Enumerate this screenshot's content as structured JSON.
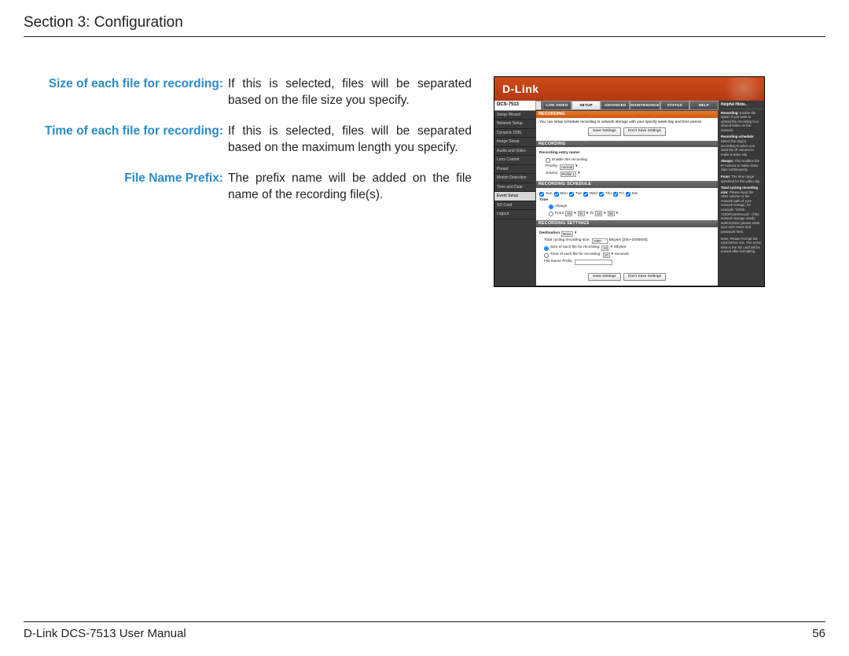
{
  "header": {
    "section_title": "Section 3: Configuration"
  },
  "defs": [
    {
      "label": "Size of each file for recording:",
      "desc": "If this is selected, files will be separated based on the file size you specify."
    },
    {
      "label": "Time of each file for recording:",
      "desc": "If this is selected, files will be separated based on the maximum length you specify."
    },
    {
      "label": "File Name Prefix:",
      "desc": "The prefix name will be added on the file name of the recording file(s)."
    }
  ],
  "shot": {
    "brand": "D-Link",
    "model": "DCS-7513",
    "side_items": [
      "Setup Wizard",
      "Network Setup",
      "Dynamic DNS",
      "Image Setup",
      "Audio and Video",
      "Lens Control",
      "Preset",
      "Motion Detection",
      "Time and Date",
      "Event Setup",
      "SD Card",
      "Logout"
    ],
    "side_current_index": 9,
    "tabs": [
      "LIVE VIDEO",
      "SETUP",
      "ADVANCED",
      "MAINTENANCE",
      "STATUS",
      "HELP"
    ],
    "tab_active_index": 1,
    "orange_title": "RECORDING",
    "intro": "You can setup schedule recording to network storage with your specify week day and time period.",
    "btn_save": "Save Settings",
    "btn_dont": "Don't Save Settings",
    "panel_recording": {
      "title": "RECORDING",
      "entry_label": "Recording entry name:",
      "enable_label": "Enable this recording",
      "priority_label": "Priority:",
      "priority_value": "normal",
      "source_label": "Source:",
      "source_value": "Profile 1"
    },
    "panel_schedule": {
      "title": "RECORDING SCHEDULE",
      "days": [
        "Sun",
        "Mon",
        "Tue",
        "Wed",
        "Thu",
        "Fri",
        "Sat"
      ],
      "time_label": "Time",
      "always_label": "Always",
      "from_label": "From",
      "from_h": "00",
      "from_m": "00",
      "to_label": "To",
      "to_h": "23",
      "to_m": "59"
    },
    "panel_settings": {
      "title": "RECORDING SETTINGS",
      "dest_label": "Destination",
      "dest_value": "None",
      "cycle_label": "Total cycling recording size:",
      "cycle_value": "1000",
      "cycle_units": "Mbytes [200~2000000]",
      "size_label": "Size of each file for recording:",
      "size_value": "10",
      "size_units": "Mbytes",
      "time_label": "Time of each file for recording:",
      "time_value": "10",
      "time_units": "seconds",
      "prefix_label": "File Name Prefix:"
    },
    "help": {
      "title": "Helpful Hints..",
      "p1b": "Recording:",
      "p1": " Enable the option if you want to upload the recording to a shared folder on the network.",
      "p2b": "Recording schedule:",
      "p2": " Select the day(s) according to when you want the IP camera to make a video clip.",
      "p3b": "Always:",
      "p3": " This enables the IP camera to make video clips continuously.",
      "p4b": "From:",
      "p4": " The time range specified for the video clip.",
      "p5b": "Total cycling recording size:",
      "p5": " Please input the HDD volume or the network path of your network storage, for example \"\\\\DNS-723\\IPCamRecord\". If the network storage needs authorization please enter your user name and password here.",
      "p6": "Note: Please Format SD card before use. The entire data in the SD card will be erased after formatting."
    }
  },
  "footer": {
    "left": "D-Link DCS-7513 User Manual",
    "page": "56"
  }
}
